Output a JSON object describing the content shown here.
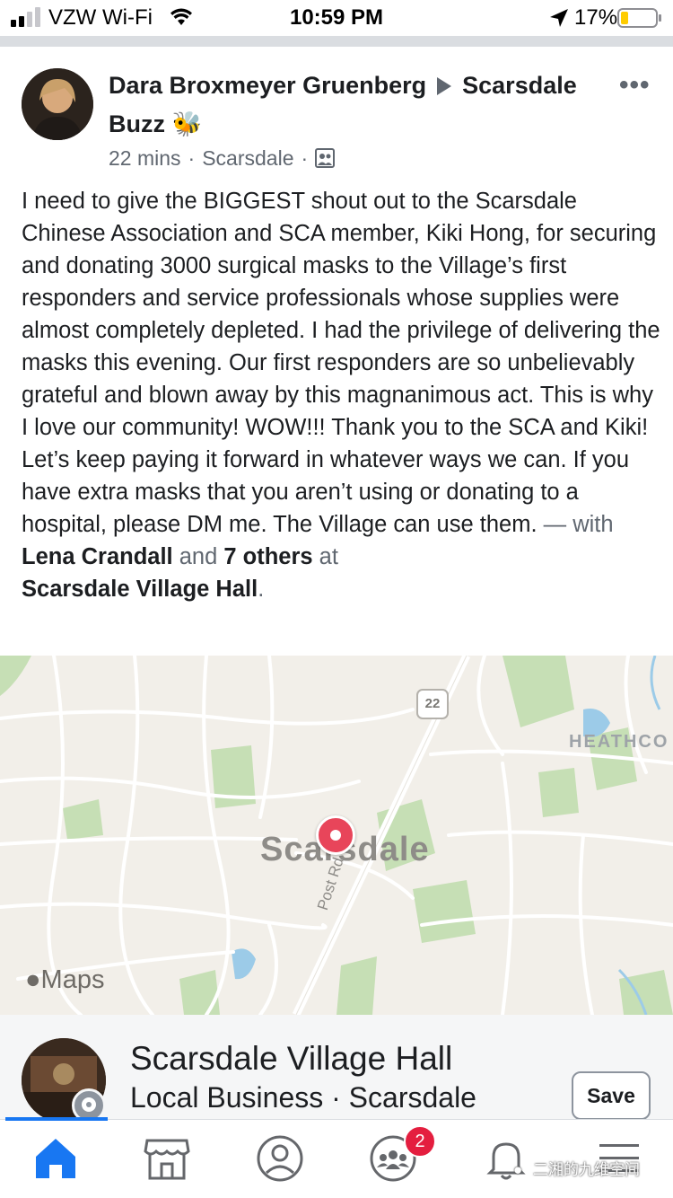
{
  "status_bar": {
    "carrier": "VZW Wi-Fi",
    "time": "10:59 PM",
    "battery": "17%",
    "icons": [
      "signal-icon",
      "wifi-icon",
      "location-arrow-icon",
      "battery-icon"
    ]
  },
  "post": {
    "author": "Dara Broxmeyer Gruenberg",
    "group": "Scarsdale Buzz",
    "group_emoji": "🐝",
    "time": "22 mins",
    "location": "Scarsdale",
    "separator": "·",
    "body_text": "I need to give the BIGGEST shout out to the Scarsdale Chinese Association and SCA member, Kiki Hong, for securing and donating 3000 surgical masks to the Village’s first responders and service professionals whose supplies were almost completely depleted. I had the privilege of delivering the masks this evening. Our first responders are so unbelievably grateful and blown away by this magnanimous act. This is why I love our community!  WOW!!! Thank you to the SCA and Kiki! Let’s keep paying it forward in whatever ways we can.  If you have extra masks that you aren’t using or donating to a hospital, please DM me. The Village can use them.",
    "with_prefix": " — with ",
    "tagged_person": "Lena Crandall",
    "and_text": " and ",
    "others": "7 others",
    "at_text": " at",
    "place": "Scarsdale Village Hall",
    "period": "."
  },
  "map": {
    "city_label": "Scarsdale",
    "area_label": "HEATHCO",
    "road_label": "Post Rd",
    "route_number": "22",
    "attribution": "Maps",
    "pin_color": "#e8455a"
  },
  "place_card": {
    "name": "Scarsdale Village Hall",
    "subtitle": "Local Business · Scarsdale",
    "save_label": "Save"
  },
  "tab_bar": {
    "tabs": [
      "home-icon",
      "marketplace-icon",
      "profile-icon",
      "groups-icon",
      "notifications-icon",
      "menu-icon"
    ],
    "groups_badge": "2",
    "active_color": "#1877f2"
  },
  "watermark": "二湘的九维空间"
}
